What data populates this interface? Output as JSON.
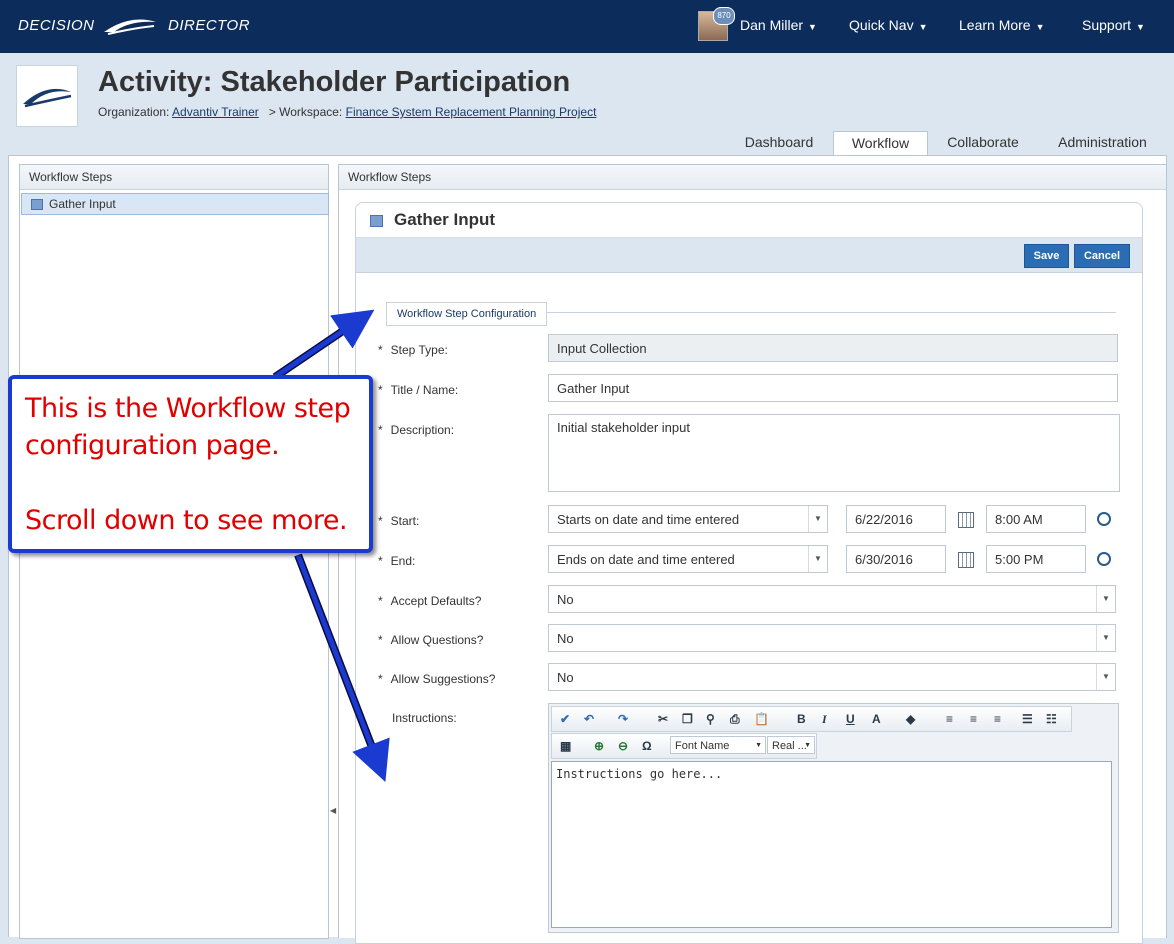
{
  "topbar": {
    "brand_left": "DECISION",
    "brand_right": "DIRECTOR",
    "badge": "870",
    "user_name": "Dan Miller",
    "nav": [
      "Quick Nav",
      "Learn More",
      "Support"
    ]
  },
  "header": {
    "title": "Activity: Stakeholder Participation",
    "org_label": "Organization:",
    "org_link": "Advantiv Trainer",
    "ws_label": "> Workspace:",
    "ws_link": "Finance System Replacement Planning Project"
  },
  "tabs": [
    {
      "label": "Dashboard",
      "active": false
    },
    {
      "label": "Workflow",
      "active": true
    },
    {
      "label": "Collaborate",
      "active": false
    },
    {
      "label": "Administration",
      "active": false
    }
  ],
  "left_panel": {
    "header": "Workflow Steps",
    "items": [
      "Gather Input"
    ]
  },
  "right_panel": {
    "header": "Workflow Steps",
    "card_title": "Gather Input",
    "save": "Save",
    "cancel": "Cancel",
    "legend": "Workflow Step Configuration",
    "fields": {
      "step_type": {
        "label": "Step Type:",
        "value": "Input Collection"
      },
      "title": {
        "label": "Title / Name:",
        "value": "Gather Input"
      },
      "description": {
        "label": "Description:",
        "value": "Initial stakeholder input"
      },
      "start": {
        "label": "Start:",
        "mode": "Starts on date and time entered",
        "date": "6/22/2016",
        "time": "8:00 AM"
      },
      "end": {
        "label": "End:",
        "mode": "Ends on date and time entered",
        "date": "6/30/2016",
        "time": "5:00 PM"
      },
      "accept_defaults": {
        "label": "Accept Defaults?",
        "value": "No"
      },
      "allow_questions": {
        "label": "Allow Questions?",
        "value": "No"
      },
      "allow_suggestions": {
        "label": "Allow Suggestions?",
        "value": "No"
      },
      "instructions": {
        "label": "Instructions:",
        "value": "Instructions go here...",
        "font_name": "Font Name",
        "font_size": "Real ..."
      }
    }
  },
  "callout": {
    "line1": "This is the Workflow step",
    "line2": "configuration page.",
    "line3": "Scroll down to see more."
  },
  "colors": {
    "topbar": "#0c2c5c",
    "accent": "#2a6db5",
    "callout_text": "#e00000",
    "callout_border": "#1a3ad0"
  }
}
